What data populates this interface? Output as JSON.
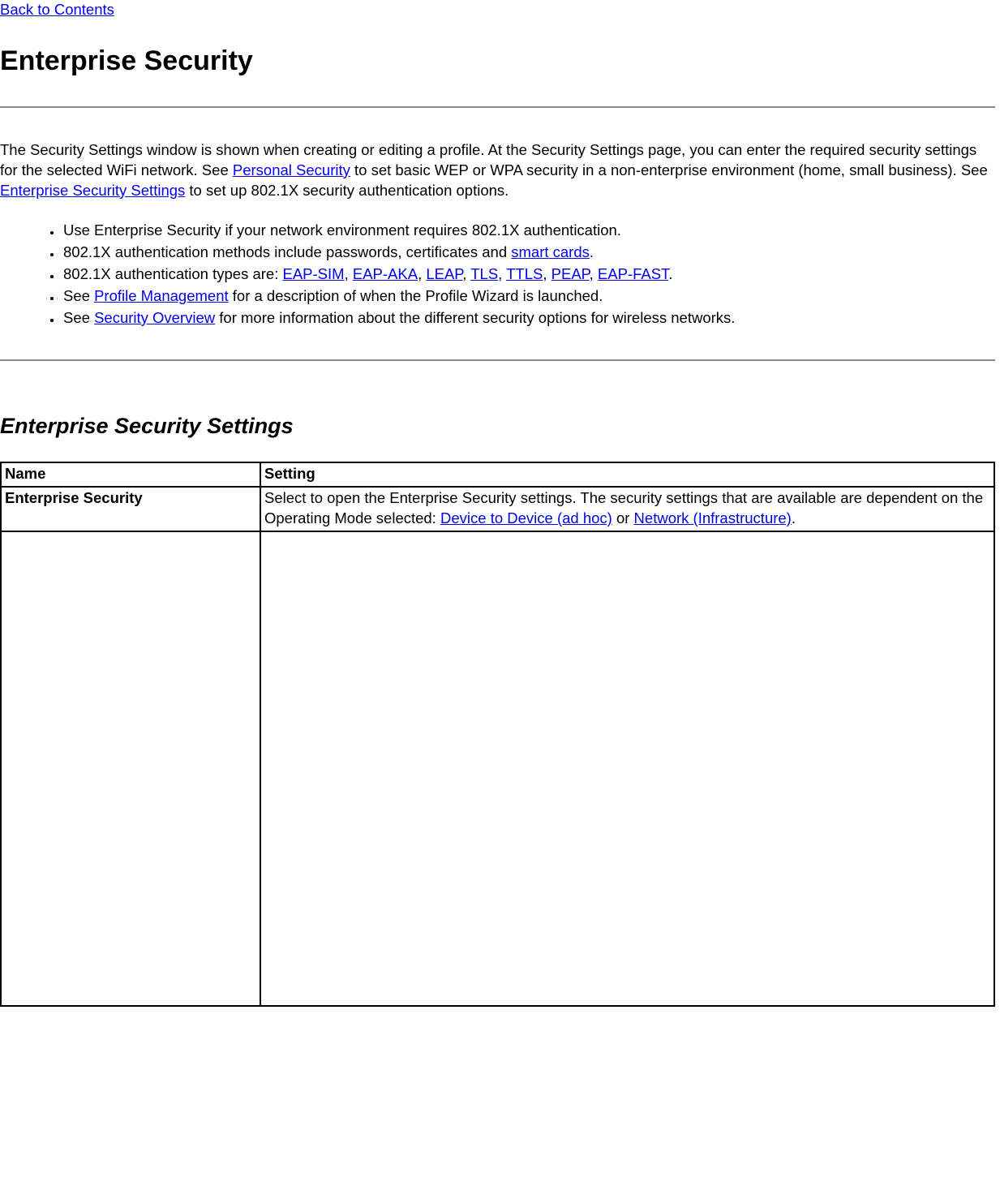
{
  "nav": {
    "back_to_contents": "Back to Contents"
  },
  "headings": {
    "h1": "Enterprise Security",
    "h2": "Enterprise Security Settings"
  },
  "intro": {
    "part1": "The Security Settings window is shown when creating or editing a profile. At the Security Settings page, you can enter the required security settings for the selected WiFi network. See ",
    "link_personal_security": "Personal Security",
    "part2": " to set basic WEP or WPA security in a non-enterprise environment (home, small business). See ",
    "link_enterprise_security_settings": "Enterprise Security Settings",
    "part3": " to set up 802.1X security authentication options."
  },
  "bullets": {
    "b1": "Use Enterprise Security if your network environment requires 802.1X authentication.",
    "b2_a": "802.1X authentication methods include passwords, certificates and ",
    "b2_link": "smart cards",
    "b2_b": ".",
    "b3_a": "802.1X authentication types are: ",
    "b3_links": {
      "eap_sim": "EAP-SIM",
      "eap_aka": "EAP-AKA",
      "leap": "LEAP",
      "tls": "TLS",
      "ttls": "TTLS",
      "peap": "PEAP",
      "eap_fast": "EAP-FAST"
    },
    "b3_sep": ", ",
    "b3_end": ".",
    "b4_a": "See ",
    "b4_link": "Profile Management",
    "b4_b": " for a description of when the Profile Wizard is launched.",
    "b5_a": "See ",
    "b5_link": "Security Overview",
    "b5_b": " for more information about the different security options for wireless networks."
  },
  "table": {
    "headers": {
      "name": "Name",
      "setting": "Setting"
    },
    "row1": {
      "name": "Enterprise Security",
      "setting_a": "Select to open the Enterprise Security settings. The security settings that are available are dependent on the Operating Mode selected: ",
      "link_adhoc": "Device to Device (ad hoc)",
      "setting_or": " or ",
      "link_infra": "Network (Infrastructure)",
      "setting_end": "."
    }
  }
}
